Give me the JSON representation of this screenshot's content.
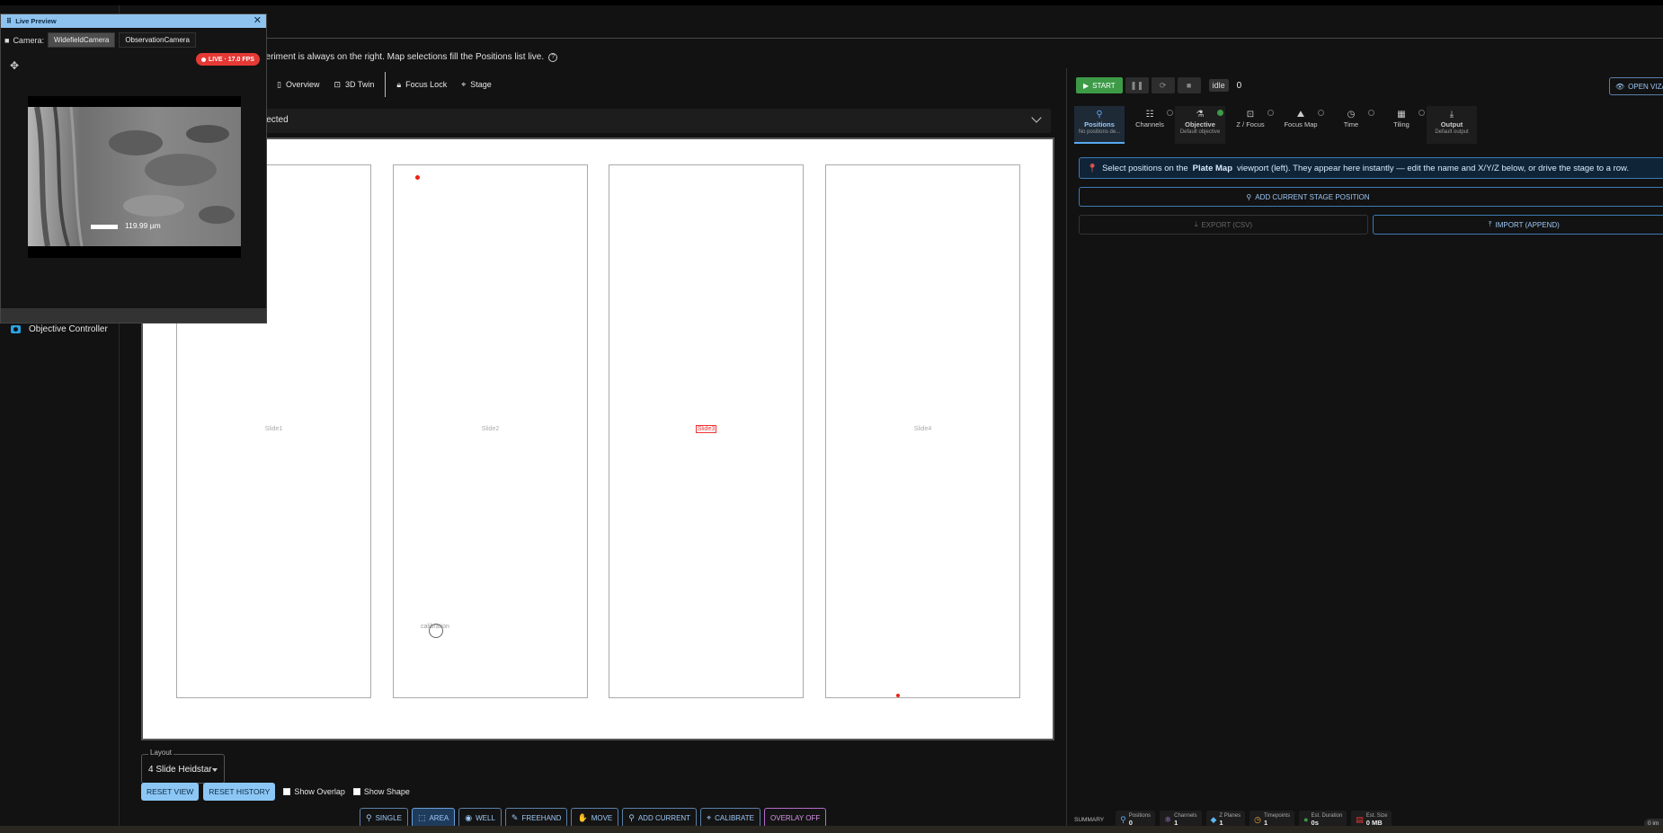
{
  "colors": {
    "accent": "#5aa9f0",
    "start": "#3d9b48",
    "live_badge": "#e53935",
    "marker": "#e21b1b",
    "overlay": "#d595e6"
  },
  "sidebar": {
    "items": [
      {
        "label": "Objective Controller",
        "icon": "camera-icon"
      }
    ]
  },
  "hint": {
    "text": "periment is always on the right. Map selections fill the Positions list live.",
    "help_icon": "?"
  },
  "view_tabs": [
    {
      "label": "Overview",
      "icon": "map-icon"
    },
    {
      "label": "3D Twin",
      "icon": "3d-icon"
    },
    {
      "label": "Focus Lock",
      "icon": "lock-icon"
    },
    {
      "label": "Stage",
      "icon": "target-icon"
    }
  ],
  "panel": {
    "label": "lected"
  },
  "plate_map": {
    "slides": [
      {
        "label": "Slide1"
      },
      {
        "label": "Slide2"
      },
      {
        "label": "Slide3"
      },
      {
        "label": "Slide4"
      }
    ],
    "calibration_label": "calibration"
  },
  "layout": {
    "legend": "Layout",
    "value": "4 Slide Heidstar"
  },
  "controls": {
    "reset_view": "RESET VIEW",
    "reset_history": "RESET HISTORY",
    "show_overlap": "Show Overlap",
    "show_shape": "Show Shape"
  },
  "tools": [
    {
      "label": "SINGLE",
      "icon": "⚲"
    },
    {
      "label": "AREA",
      "icon": "⬚"
    },
    {
      "label": "WELL",
      "icon": "◉"
    },
    {
      "label": "FREEHAND",
      "icon": "✎"
    },
    {
      "label": "MOVE",
      "icon": "✋"
    },
    {
      "label": "ADD CURRENT",
      "icon": "⚲"
    },
    {
      "label": "CALIBRATE",
      "icon": "⌖"
    },
    {
      "label": "OVERLAY OFF",
      "icon": ""
    }
  ],
  "run": {
    "start": "START",
    "pause": "❚❚",
    "resume": "⟳",
    "stop": "■",
    "state": "idle",
    "count": "0",
    "open_viz": "OPEN VIZA"
  },
  "exp_tabs": [
    {
      "label": "Positions",
      "sub": "No positions de...",
      "icon": "⚲"
    },
    {
      "label": "Channels",
      "sub": "",
      "icon": "☷"
    },
    {
      "label": "Objective",
      "sub": "Default objective",
      "icon": "⚗"
    },
    {
      "label": "Z / Focus",
      "sub": "",
      "icon": "⊡"
    },
    {
      "label": "Focus Map",
      "sub": "",
      "icon": "⛰"
    },
    {
      "label": "Time",
      "sub": "",
      "icon": "◷"
    },
    {
      "label": "Tiling",
      "sub": "",
      "icon": "▦"
    },
    {
      "label": "Output",
      "sub": "Default output",
      "icon": "⤓"
    }
  ],
  "info": {
    "before": "Select positions on the",
    "bold": "Plate Map",
    "after": "viewport (left). They appear here instantly — edit the name and X/Y/Z below, or drive the stage to a row."
  },
  "actions": {
    "add_stage": "ADD CURRENT STAGE POSITION",
    "export": "EXPORT (CSV)",
    "import": "IMPORT (APPEND)"
  },
  "summary": {
    "label": "SUMMARY",
    "chips": [
      {
        "label": "Positions",
        "value": "0",
        "color": "#5aa9f0"
      },
      {
        "label": "Channels",
        "value": "1",
        "color": "#c58af0"
      },
      {
        "label": "Z Planes",
        "value": "1",
        "color": "#5ab8f0"
      },
      {
        "label": "Timepoints",
        "value": "1",
        "color": "#f0a83d"
      },
      {
        "label": "Est. Duration",
        "value": "0s",
        "color": "#3d9b48"
      },
      {
        "label": "Est. Size",
        "value": "0 MB",
        "color": "#e53935"
      }
    ],
    "tail": "0 im"
  },
  "live_preview": {
    "title": "Live Preview",
    "camera_label": "Camera:",
    "cameras": [
      "WidefieldCamera",
      "ObservationCamera"
    ],
    "fps": "LIVE · 17.0 FPS",
    "scale": "119.99 µm"
  }
}
